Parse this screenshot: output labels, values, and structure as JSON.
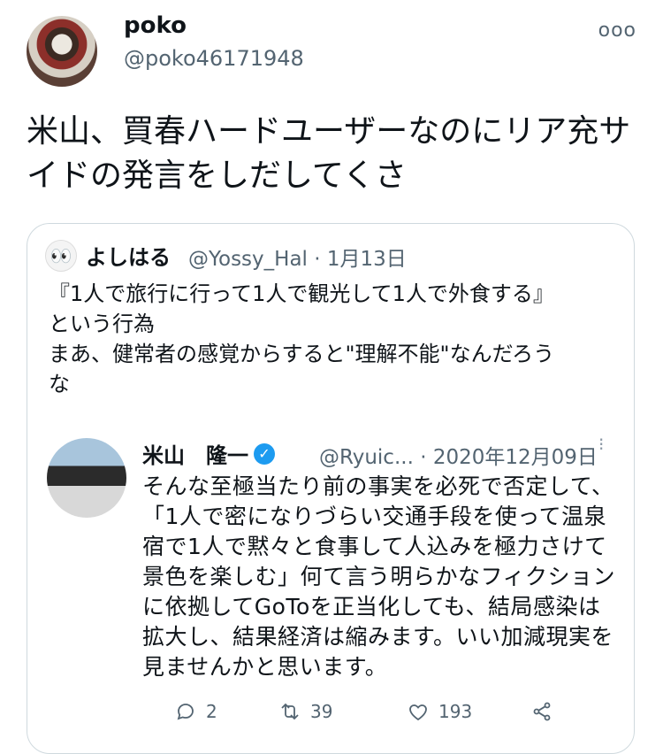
{
  "author": {
    "name": "poko",
    "handle": "@poko46171948"
  },
  "menu_icon": "more-horizontal-icon",
  "tweet_text": "米山、買春ハードユーザーなのにリア充サイドの発言をしだしてくさ",
  "quote": {
    "avatar_icon": "face-icon",
    "name": "よしはる",
    "handle": "@Yossy_Hal",
    "date": "1月13日",
    "separator": "·",
    "text_lines": [
      "『1人で旅行に行って1人で観光して1人で外食する』",
      "という行為",
      "まあ、健常者の感覚からすると\"理解不能\"なんだろう",
      "な"
    ],
    "embedded": {
      "name": "米山　隆一",
      "handle": "@Ryuic...",
      "date": "2020年12月09日",
      "text": "そんな至極当たり前の事実を必死で否定して、「1人で密になりづらい交通手段を使って温泉宿で1人で黙々と食事して人込みを極力さけて景色を楽しむ」何て言う明らかなフィクションに依拠してGoToを正当化しても、結局感染は拡大し、結果経済は縮みます。いい加減現実を見ませんかと思います。",
      "reply_count": "2",
      "retweet_count": "39",
      "like_count": "193",
      "verified_color": "#1d9bf0"
    }
  }
}
